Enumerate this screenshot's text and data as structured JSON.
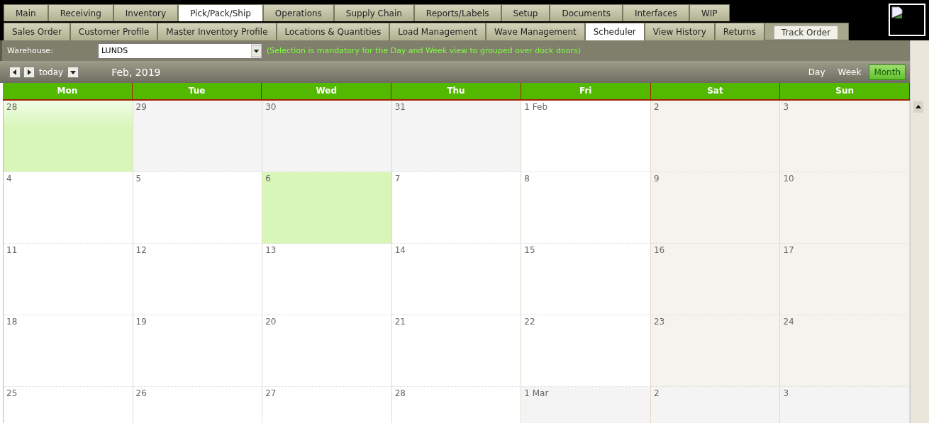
{
  "main_tabs": [
    {
      "label": "Main",
      "selected": false
    },
    {
      "label": "Receiving",
      "selected": false
    },
    {
      "label": "Inventory",
      "selected": false
    },
    {
      "label": "Pick/Pack/Ship",
      "selected": true
    },
    {
      "label": "Operations",
      "selected": false
    },
    {
      "label": "Supply Chain",
      "selected": false
    },
    {
      "label": "Reports/Labels",
      "selected": false
    },
    {
      "label": "Setup",
      "selected": false
    },
    {
      "label": "Documents",
      "selected": false
    },
    {
      "label": "Interfaces",
      "selected": false
    },
    {
      "label": "WIP",
      "selected": false
    }
  ],
  "sub_tabs": [
    {
      "label": "Sales Order",
      "selected": false
    },
    {
      "label": "Customer Profile",
      "selected": false
    },
    {
      "label": "Master Inventory Profile",
      "selected": false
    },
    {
      "label": "Locations & Quantities",
      "selected": false
    },
    {
      "label": "Load Management",
      "selected": false
    },
    {
      "label": "Wave Management",
      "selected": false
    },
    {
      "label": "Scheduler",
      "selected": true
    },
    {
      "label": "View History",
      "selected": false
    },
    {
      "label": "Returns",
      "selected": false
    }
  ],
  "track_button": "Track Order",
  "warehouse": {
    "label": "Warehouse:",
    "value": "LUNDS",
    "note": "(Selection is mandatory for the Day and Week view to grouped over dock doors)"
  },
  "toolbar": {
    "today": "today",
    "title": "Feb, 2019",
    "views": [
      {
        "label": "Day",
        "selected": false
      },
      {
        "label": "Week",
        "selected": false
      },
      {
        "label": "Month",
        "selected": true
      }
    ]
  },
  "weekdays": [
    "Mon",
    "Tue",
    "Wed",
    "Thu",
    "Fri",
    "Sat",
    "Sun"
  ],
  "weeks": [
    [
      {
        "label": "28",
        "kind": "hover"
      },
      {
        "label": "29",
        "kind": "other"
      },
      {
        "label": "30",
        "kind": "other"
      },
      {
        "label": "31",
        "kind": "other"
      },
      {
        "label": "1 Feb",
        "kind": "normal"
      },
      {
        "label": "2",
        "kind": "weekend"
      },
      {
        "label": "3",
        "kind": "weekend"
      }
    ],
    [
      {
        "label": "4",
        "kind": "normal"
      },
      {
        "label": "5",
        "kind": "normal"
      },
      {
        "label": "6",
        "kind": "today"
      },
      {
        "label": "7",
        "kind": "normal"
      },
      {
        "label": "8",
        "kind": "normal"
      },
      {
        "label": "9",
        "kind": "weekend"
      },
      {
        "label": "10",
        "kind": "weekend"
      }
    ],
    [
      {
        "label": "11",
        "kind": "normal"
      },
      {
        "label": "12",
        "kind": "normal"
      },
      {
        "label": "13",
        "kind": "normal"
      },
      {
        "label": "14",
        "kind": "normal"
      },
      {
        "label": "15",
        "kind": "normal"
      },
      {
        "label": "16",
        "kind": "weekend"
      },
      {
        "label": "17",
        "kind": "weekend"
      }
    ],
    [
      {
        "label": "18",
        "kind": "normal"
      },
      {
        "label": "19",
        "kind": "normal"
      },
      {
        "label": "20",
        "kind": "normal"
      },
      {
        "label": "21",
        "kind": "normal"
      },
      {
        "label": "22",
        "kind": "normal"
      },
      {
        "label": "23",
        "kind": "weekend"
      },
      {
        "label": "24",
        "kind": "weekend"
      }
    ],
    [
      {
        "label": "25",
        "kind": "normal"
      },
      {
        "label": "26",
        "kind": "normal"
      },
      {
        "label": "27",
        "kind": "normal"
      },
      {
        "label": "28",
        "kind": "normal"
      },
      {
        "label": "1 Mar",
        "kind": "other"
      },
      {
        "label": "2",
        "kind": "other"
      },
      {
        "label": "3",
        "kind": "other"
      }
    ]
  ]
}
